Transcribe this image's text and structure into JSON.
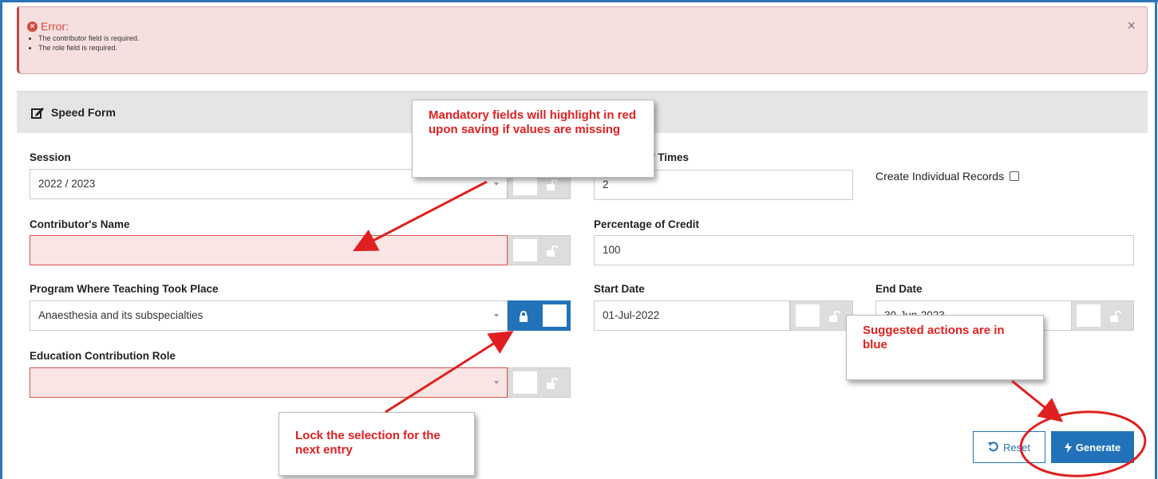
{
  "alert": {
    "title": "Error:",
    "messages": [
      "The contributor field is required.",
      "The role field is required."
    ],
    "close": "×"
  },
  "panel": {
    "title": "Speed Form"
  },
  "fields": {
    "session": {
      "label": "Session",
      "value": "2022 / 2023"
    },
    "times": {
      "label_visible": "f Times",
      "value": "2"
    },
    "individual": {
      "label": "Create Individual Records",
      "checked": false
    },
    "contributor": {
      "label": "Contributor's Name",
      "value": ""
    },
    "credit": {
      "label": "Percentage of Credit",
      "value": "100"
    },
    "program": {
      "label": "Program Where Teaching Took Place",
      "value": "Anaesthesia and its subspecialties",
      "locked": true
    },
    "start_date": {
      "label": "Start Date",
      "value": "01-Jul-2022"
    },
    "end_date": {
      "label": "End Date",
      "value": "30-Jun-2023"
    },
    "role": {
      "label": "Education Contribution Role",
      "value": ""
    }
  },
  "buttons": {
    "reset": "Reset",
    "generate": "Generate"
  },
  "callouts": {
    "mandatory": "Mandatory fields will highlight in red upon saving if values are missing",
    "suggested": "Suggested actions are in blue",
    "lock": "Lock the selection for the next entry"
  },
  "colors": {
    "accent": "#2272b9",
    "error": "#d9534f",
    "annotation": "#e02020"
  },
  "icons": {
    "alert": "error-circle-icon",
    "edit": "edit-icon",
    "lock": "lock-icon",
    "reset": "undo-icon",
    "generate": "bolt-icon",
    "close": "close-icon"
  }
}
